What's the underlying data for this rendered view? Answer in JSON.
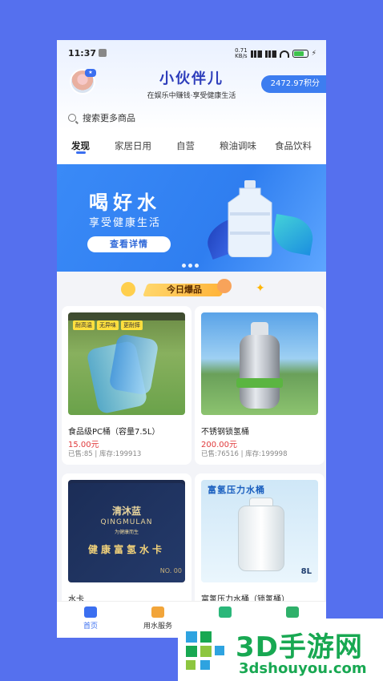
{
  "status": {
    "time": "11:37",
    "speed": "0.71\nKB/s",
    "network": "HD",
    "battery_level": 0.6
  },
  "header": {
    "title": "小伙伴儿",
    "subtitle": "在娱乐中赚钱·享受健康生活",
    "points": "2472.97积分"
  },
  "search": {
    "placeholder": "搜索更多商品"
  },
  "tabs": [
    {
      "label": "发现"
    },
    {
      "label": "家居日用"
    },
    {
      "label": "自营"
    },
    {
      "label": "粮油调味"
    },
    {
      "label": "食品饮料"
    }
  ],
  "banner": {
    "title": "喝好水",
    "subtitle": "享受健康生活",
    "button": "查看详情"
  },
  "section": {
    "title": "今日爆品"
  },
  "products": [
    {
      "name": "食品级PC桶（容量7.5L）",
      "price": "15.00元",
      "stats": "已售:85 | 库存:199913",
      "tags": [
        "耐高温",
        "无异味",
        "更耐摔"
      ]
    },
    {
      "name": "不锈钢锁氢桶",
      "price": "200.00元",
      "stats": "已售:76516 | 库存:199998"
    },
    {
      "name": "水卡",
      "card_brand": "清沐蓝",
      "card_en": "QINGMULAN",
      "card_slogan": "为健康而生",
      "card_text": "健康富氢水卡",
      "card_no": "NO. 00"
    },
    {
      "name": "富氢压力水桶（锁氢桶）",
      "image_title": "富氢压力水桶",
      "image_badge": "8L"
    }
  ],
  "nav": [
    {
      "label": "首页"
    },
    {
      "label": "用水服务"
    },
    {
      "label": ""
    },
    {
      "label": ""
    }
  ],
  "watermark": {
    "title": "3D手游网",
    "url": "3dshouyou.com"
  }
}
